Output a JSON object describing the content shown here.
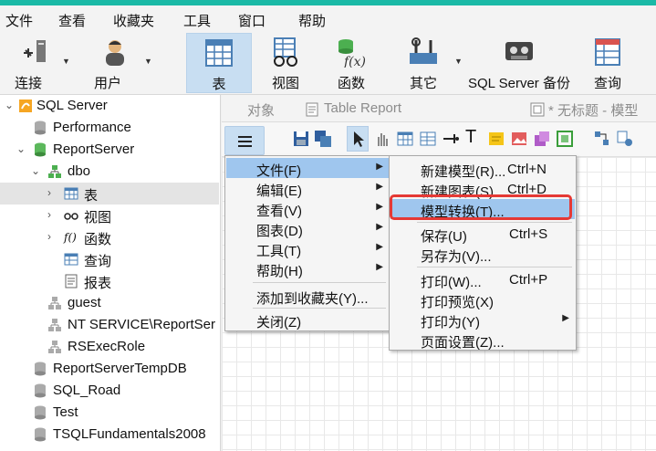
{
  "menubar": {
    "items": [
      "文件",
      "查看",
      "收藏夹",
      "工具",
      "窗口",
      "帮助"
    ]
  },
  "ribbon": {
    "connect": "连接",
    "user": "用户",
    "table": "表",
    "view": "视图",
    "function": "函数",
    "other": "其它",
    "backup": "SQL Server 备份",
    "query": "查询"
  },
  "tree": {
    "server": "SQL Server",
    "performance": "Performance",
    "reportserver": "ReportServer",
    "dbo": "dbo",
    "tables": "表",
    "views": "视图",
    "functions": "函数",
    "queries": "查询",
    "reports": "报表",
    "guest": "guest",
    "ntservice": "NT SERVICE\\ReportSer",
    "rsexec": "RSExecRole",
    "tempdb": "ReportServerTempDB",
    "sqlroad": "SQL_Road",
    "test": "Test",
    "tsql": "TSQLFundamentals2008"
  },
  "tabs": {
    "objects": "对象",
    "table_report": "Table Report",
    "untitled": "* 无标题 - 模型"
  },
  "menu_main": [
    {
      "label": "文件(F)"
    },
    {
      "label": "编辑(E)"
    },
    {
      "label": "查看(V)"
    },
    {
      "label": "图表(D)"
    },
    {
      "label": "工具(T)"
    },
    {
      "label": "帮助(H)"
    },
    {
      "label": "添加到收藏夹(Y)..."
    },
    {
      "label": "关闭(Z)"
    }
  ],
  "menu_file": [
    {
      "label": "新建模型(R)...",
      "shortcut": "Ctrl+N"
    },
    {
      "label": "新建图表(S)",
      "shortcut": "Ctrl+D"
    },
    {
      "label": "模型转换(T)..."
    },
    {
      "label": "保存(U)",
      "shortcut": "Ctrl+S"
    },
    {
      "label": "另存为(V)..."
    },
    {
      "label": "打印(W)...",
      "shortcut": "Ctrl+P"
    },
    {
      "label": "打印预览(X)"
    },
    {
      "label": "打印为(Y)"
    },
    {
      "label": "页面设置(Z)..."
    }
  ],
  "colors": {
    "accent": "#1ab9a6",
    "highlight": "#9fc6ee",
    "annotation": "#e53935"
  }
}
